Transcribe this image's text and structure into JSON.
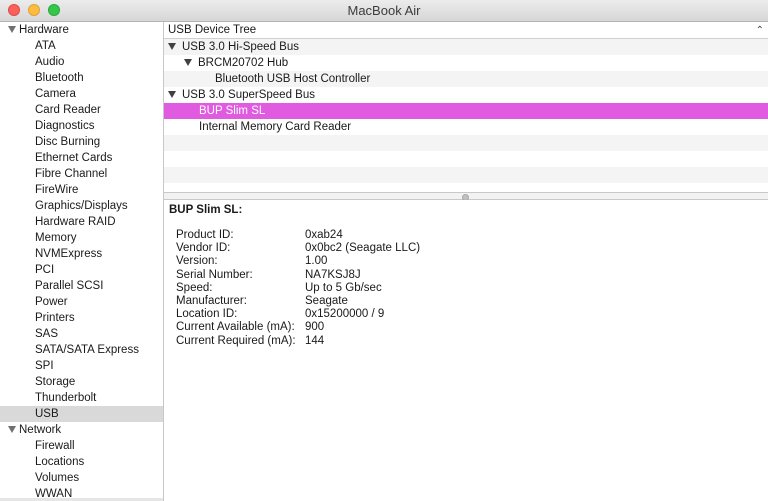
{
  "window": {
    "title": "MacBook Air"
  },
  "sidebar": {
    "categories": [
      {
        "label": "Hardware",
        "items": [
          "ATA",
          "Audio",
          "Bluetooth",
          "Camera",
          "Card Reader",
          "Diagnostics",
          "Disc Burning",
          "Ethernet Cards",
          "Fibre Channel",
          "FireWire",
          "Graphics/Displays",
          "Hardware RAID",
          "Memory",
          "NVMExpress",
          "PCI",
          "Parallel SCSI",
          "Power",
          "Printers",
          "SAS",
          "SATA/SATA Express",
          "SPI",
          "Storage",
          "Thunderbolt",
          "USB"
        ]
      },
      {
        "label": "Network",
        "items": [
          "Firewall",
          "Locations",
          "Volumes",
          "WWAN"
        ]
      }
    ],
    "selected": "USB"
  },
  "tree": {
    "header": "USB Device Tree",
    "rows": [
      {
        "label": "USB 3.0 Hi-Speed Bus",
        "level": 0,
        "expanded": true
      },
      {
        "label": "BRCM20702 Hub",
        "level": 1,
        "expanded": true
      },
      {
        "label": "Bluetooth USB Host Controller",
        "level": 2
      },
      {
        "label": "USB 3.0 SuperSpeed Bus",
        "level": 0,
        "expanded": true
      },
      {
        "label": "BUP Slim SL",
        "level": 1,
        "selected": true
      },
      {
        "label": "Internal Memory Card Reader",
        "level": 1
      }
    ]
  },
  "detail": {
    "title": "BUP Slim SL:",
    "properties": [
      {
        "label": "Product ID:",
        "value": "0xab24"
      },
      {
        "label": "Vendor ID:",
        "value": "0x0bc2  (Seagate LLC)"
      },
      {
        "label": "Version:",
        "value": "1.00"
      },
      {
        "label": "Serial Number:",
        "value": "NA7KSJ8J"
      },
      {
        "label": "Speed:",
        "value": "Up to 5 Gb/sec"
      },
      {
        "label": "Manufacturer:",
        "value": "Seagate"
      },
      {
        "label": "Location ID:",
        "value": "0x15200000 / 9"
      },
      {
        "label": "Current Available (mA):",
        "value": "900"
      },
      {
        "label": "Current Required (mA):",
        "value": "144"
      }
    ]
  },
  "colors": {
    "selection": "#e05be0",
    "sidebar_selection": "#d9d9d9"
  }
}
